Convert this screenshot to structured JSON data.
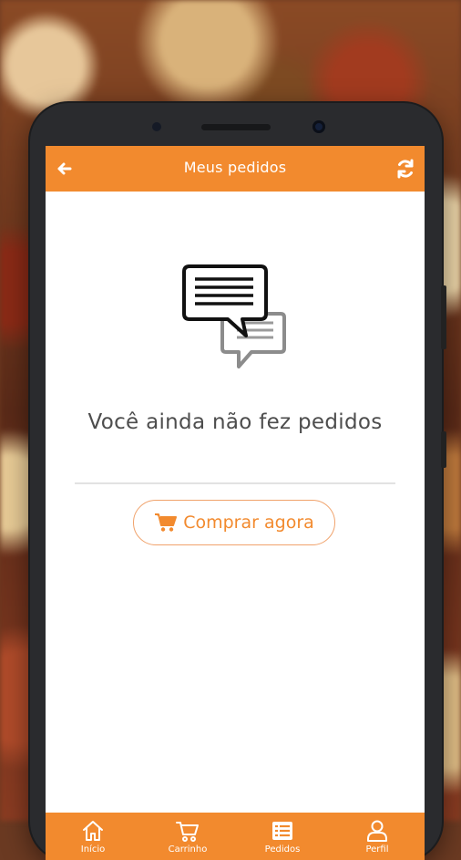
{
  "app": {
    "title": "Meus pedidos"
  },
  "empty_state": {
    "message": "Você ainda não fez pedidos",
    "action_label": "Comprar agora"
  },
  "bottom_nav": {
    "items": [
      {
        "label": "Início",
        "icon": "home-icon"
      },
      {
        "label": "Carrinho",
        "icon": "cart-icon"
      },
      {
        "label": "Pedidos",
        "icon": "list-icon"
      },
      {
        "label": "Perfil",
        "icon": "user-icon"
      }
    ]
  },
  "colors": {
    "accent": "#f28a2e",
    "text": "#4d4d4d",
    "divider": "#e2e2e2"
  }
}
